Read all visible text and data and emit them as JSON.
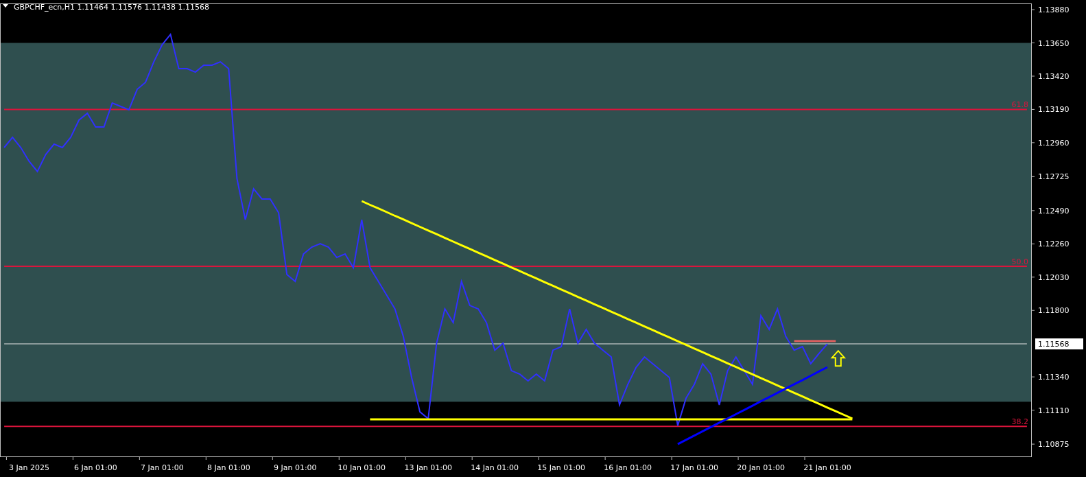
{
  "chart": {
    "current_price": "1.11568",
    "fibonacci_labels": [
      "61.8",
      "50.0",
      "38.2"
    ],
    "chart_data": {
      "type": "line",
      "title": "GBPCHF_ecn,H1  1.11464 1.11576 1.11438 1.11568",
      "categories": [
        null,
        null,
        null,
        "3 Jan 2025",
        null,
        null,
        null,
        null,
        null,
        null,
        null,
        "6 Jan 01:00",
        null,
        null,
        null,
        null,
        null,
        null,
        null,
        "7 Jan 01:00",
        null,
        null,
        null,
        null,
        null,
        null,
        null,
        "8 Jan 01:00",
        null,
        null,
        null,
        null,
        null,
        null,
        null,
        "9 Jan 01:00",
        null,
        null,
        null,
        null,
        null,
        null,
        null,
        "10 Jan 01:00",
        null,
        null,
        null,
        null,
        null,
        null,
        null,
        "13 Jan 01:00",
        null,
        null,
        null,
        null,
        null,
        null,
        null,
        "14 Jan 01:00",
        null,
        null,
        null,
        null,
        null,
        null,
        null,
        "15 Jan 01:00",
        null,
        null,
        null,
        null,
        null,
        null,
        null,
        "16 Jan 01:00",
        null,
        null,
        null,
        null,
        null,
        null,
        null,
        "17 Jan 01:00",
        null,
        null,
        null,
        null,
        null,
        null,
        null,
        "20 Jan 01:00",
        null,
        null,
        null,
        null,
        null,
        null,
        null,
        "21 Jan 01:00",
        null,
        null,
        null,
        null,
        null,
        null,
        null,
        null,
        null,
        null,
        null,
        null,
        null,
        null,
        null,
        null,
        null,
        null,
        null,
        null,
        null,
        null,
        null,
        null
      ],
      "ylim": [
        1.1079,
        1.13923
      ],
      "yticks": [
        {
          "value": 1.1388,
          "label": "1.13880"
        },
        {
          "value": 1.1365,
          "label": "1.13650"
        },
        {
          "value": 1.1342,
          "label": "1.13420"
        },
        {
          "value": 1.1319,
          "label": "1.13190"
        },
        {
          "value": 1.1296,
          "label": "1.12960"
        },
        {
          "value": 1.12725,
          "label": "1.12725"
        },
        {
          "value": 1.1249,
          "label": "1.12490"
        },
        {
          "value": 1.1226,
          "label": "1.12260"
        },
        {
          "value": 1.1203,
          "label": "1.12030"
        },
        {
          "value": 1.118,
          "label": "1.11800"
        },
        {
          "value": 1.1134,
          "label": "1.11340"
        },
        {
          "value": 1.1111,
          "label": "1.11110"
        },
        {
          "value": 1.10875,
          "label": "1.10875"
        }
      ],
      "series": [
        {
          "color": "#dc143c",
          "values": [
            1.1319,
            1.1319,
            1.1319,
            1.1319,
            1.1319,
            1.1319,
            1.1319,
            1.1319,
            1.1319,
            1.1319,
            1.1319,
            1.1319,
            1.1319,
            1.1319,
            1.1319,
            1.1319,
            1.1319,
            1.1319,
            1.1319,
            1.1319,
            1.1319,
            1.1319,
            1.1319,
            1.1319,
            1.1319,
            1.1319,
            1.1319,
            1.1319,
            1.1319,
            1.1319,
            1.1319,
            1.1319,
            1.1319,
            1.1319,
            1.1319,
            1.1319,
            1.1319,
            1.1319,
            1.1319,
            1.1319,
            1.1319,
            1.1319,
            1.1319,
            1.1319,
            1.1319,
            1.1319,
            1.1319,
            1.1319,
            1.1319,
            1.1319,
            1.1319,
            1.1319,
            1.1319,
            1.1319,
            1.1319,
            1.1319,
            1.1319,
            1.1319,
            1.1319,
            1.1319,
            1.1319,
            1.1319,
            1.1319,
            1.1319,
            1.1319,
            1.1319,
            1.1319,
            1.1319,
            1.1319,
            1.1319,
            1.1319,
            1.1319,
            1.1319,
            1.1319,
            1.1319,
            1.1319,
            1.1319,
            1.1319,
            1.1319,
            1.1319,
            1.1319,
            1.1319,
            1.1319,
            1.1319,
            1.1319,
            1.1319,
            1.1319,
            1.1319,
            1.1319,
            1.1319,
            1.1319,
            1.1319,
            1.1319,
            1.1319,
            1.1319,
            1.1319,
            1.1319,
            1.1319,
            1.1319,
            1.1319,
            1.1319,
            1.1319,
            1.1319,
            1.1319,
            1.1319,
            1.1319,
            1.1319,
            1.1319,
            1.1319,
            1.1319,
            1.1319,
            1.1319,
            1.1319,
            1.1319,
            1.1319,
            1.1319,
            1.1319,
            1.1319,
            1.1319,
            1.1319,
            1.1319,
            1.1319,
            1.1319,
            1.1319
          ]
        },
        {
          "color": "#dc143c",
          "values": [
            1.12105,
            1.12105,
            1.12105,
            1.12105,
            1.12105,
            1.12105,
            1.12105,
            1.12105,
            1.12105,
            1.12105,
            1.12105,
            1.12105,
            1.12105,
            1.12105,
            1.12105,
            1.12105,
            1.12105,
            1.12105,
            1.12105,
            1.12105,
            1.12105,
            1.12105,
            1.12105,
            1.12105,
            1.12105,
            1.12105,
            1.12105,
            1.12105,
            1.12105,
            1.12105,
            1.12105,
            1.12105,
            1.12105,
            1.12105,
            1.12105,
            1.12105,
            1.12105,
            1.12105,
            1.12105,
            1.12105,
            1.12105,
            1.12105,
            1.12105,
            1.12105,
            1.12105,
            1.12105,
            1.12105,
            1.12105,
            1.12105,
            1.12105,
            1.12105,
            1.12105,
            1.12105,
            1.12105,
            1.12105,
            1.12105,
            1.12105,
            1.12105,
            1.12105,
            1.12105,
            1.12105,
            1.12105,
            1.12105,
            1.12105,
            1.12105,
            1.12105,
            1.12105,
            1.12105,
            1.12105,
            1.12105,
            1.12105,
            1.12105,
            1.12105,
            1.12105,
            1.12105,
            1.12105,
            1.12105,
            1.12105,
            1.12105,
            1.12105,
            1.12105,
            1.12105,
            1.12105,
            1.12105,
            1.12105,
            1.12105,
            1.12105,
            1.12105,
            1.12105,
            1.12105,
            1.12105,
            1.12105,
            1.12105,
            1.12105,
            1.12105,
            1.12105,
            1.12105,
            1.12105,
            1.12105,
            1.12105,
            1.12105,
            1.12105,
            1.12105,
            1.12105,
            1.12105,
            1.12105,
            1.12105,
            1.12105,
            1.12105,
            1.12105,
            1.12105,
            1.12105,
            1.12105,
            1.12105,
            1.12105,
            1.12105,
            1.12105,
            1.12105,
            1.12105,
            1.12105,
            1.12105,
            1.12105,
            1.12105,
            1.12105
          ]
        },
        {
          "color": "#dc143c",
          "values": [
            1.10998,
            1.10998,
            1.10998,
            1.10998,
            1.10998,
            1.10998,
            1.10998,
            1.10998,
            1.10998,
            1.10998,
            1.10998,
            1.10998,
            1.10998,
            1.10998,
            1.10998,
            1.10998,
            1.10998,
            1.10998,
            1.10998,
            1.10998,
            1.10998,
            1.10998,
            1.10998,
            1.10998,
            1.10998,
            1.10998,
            1.10998,
            1.10998,
            1.10998,
            1.10998,
            1.10998,
            1.10998,
            1.10998,
            1.10998,
            1.10998,
            1.10998,
            1.10998,
            1.10998,
            1.10998,
            1.10998,
            1.10998,
            1.10998,
            1.10998,
            1.10998,
            1.10998,
            1.10998,
            1.10998,
            1.10998,
            1.10998,
            1.10998,
            1.10998,
            1.10998,
            1.10998,
            1.10998,
            1.10998,
            1.10998,
            1.10998,
            1.10998,
            1.10998,
            1.10998,
            1.10998,
            1.10998,
            1.10998,
            1.10998,
            1.10998,
            1.10998,
            1.10998,
            1.10998,
            1.10998,
            1.10998,
            1.10998,
            1.10998,
            1.10998,
            1.10998,
            1.10998,
            1.10998,
            1.10998,
            1.10998,
            1.10998,
            1.10998,
            1.10998,
            1.10998,
            1.10998,
            1.10998,
            1.10998,
            1.10998,
            1.10998,
            1.10998,
            1.10998,
            1.10998,
            1.10998,
            1.10998,
            1.10998,
            1.10998,
            1.10998,
            1.10998,
            1.10998,
            1.10998,
            1.10998,
            1.10998,
            1.10998,
            1.10998,
            1.10998,
            1.10998,
            1.10998,
            1.10998,
            1.10998,
            1.10998,
            1.10998,
            1.10998,
            1.10998,
            1.10998,
            1.10998,
            1.10998,
            1.10998,
            1.10998,
            1.10998,
            1.10998,
            1.10998,
            1.10998,
            1.10998,
            1.10998,
            1.10998,
            1.10998
          ]
        },
        {
          "color": "#8a9a9a",
          "values": [
            1.11568,
            1.11568,
            1.11568,
            1.11568,
            1.11568,
            1.11568,
            1.11568,
            1.11568,
            1.11568,
            1.11568,
            1.11568,
            1.11568,
            1.11568,
            1.11568,
            1.11568,
            1.11568,
            1.11568,
            1.11568,
            1.11568,
            1.11568,
            1.11568,
            1.11568,
            1.11568,
            1.11568,
            1.11568,
            1.11568,
            1.11568,
            1.11568,
            1.11568,
            1.11568,
            1.11568,
            1.11568,
            1.11568,
            1.11568,
            1.11568,
            1.11568,
            1.11568,
            1.11568,
            1.11568,
            1.11568,
            1.11568,
            1.11568,
            1.11568,
            1.11568,
            1.11568,
            1.11568,
            1.11568,
            1.11568,
            1.11568,
            1.11568,
            1.11568,
            1.11568,
            1.11568,
            1.11568,
            1.11568,
            1.11568,
            1.11568,
            1.11568,
            1.11568,
            1.11568,
            1.11568,
            1.11568,
            1.11568,
            1.11568,
            1.11568,
            1.11568,
            1.11568,
            1.11568,
            1.11568,
            1.11568,
            1.11568,
            1.11568,
            1.11568,
            1.11568,
            1.11568,
            1.11568,
            1.11568,
            1.11568,
            1.11568,
            1.11568,
            1.11568,
            1.11568,
            1.11568,
            1.11568,
            1.11568,
            1.11568,
            1.11568,
            1.11568,
            1.11568,
            1.11568,
            1.11568,
            1.11568,
            1.11568,
            1.11568,
            1.11568,
            1.11568,
            1.11568,
            1.11568,
            1.11568,
            1.11568,
            1.11568,
            1.11568,
            1.11568,
            1.11568,
            1.11568,
            1.11568,
            1.11568,
            1.11568,
            1.11568,
            1.11568,
            1.11568,
            1.11568,
            1.11568,
            1.11568,
            1.11568,
            1.11568,
            1.11568,
            1.11568,
            1.11568,
            1.11568,
            1.11568,
            1.11568,
            1.11568,
            1.11568
          ]
        },
        {
          "color": "#3030ff",
          "values": [
            1.12926,
            1.12997,
            1.12926,
            1.12831,
            1.1276,
            1.12878,
            1.1295,
            1.12926,
            1.12997,
            1.13116,
            1.13163,
            1.13068,
            1.13068,
            1.13234,
            1.13211,
            1.13187,
            1.13329,
            1.13377,
            1.13519,
            1.13638,
            1.13709,
            1.13472,
            1.13472,
            1.13448,
            1.13496,
            1.13496,
            1.13519,
            1.13472,
            1.12712,
            1.12427,
            1.12641,
            1.1257,
            1.1257,
            1.12475,
            1.12048,
            1.12,
            1.1219,
            1.12238,
            1.12261,
            1.12238,
            1.12166,
            1.1219,
            1.12095,
            1.12427,
            1.12095,
            1.12,
            1.11905,
            1.1181,
            1.1162,
            1.11336,
            1.11098,
            1.11051,
            1.11573,
            1.1181,
            1.11715,
            1.12,
            1.11834,
            1.1181,
            1.11715,
            1.11525,
            1.11573,
            1.11383,
            1.11359,
            1.11312,
            1.11359,
            1.11312,
            1.11525,
            1.11549,
            1.1181,
            1.11573,
            1.11668,
            1.11573,
            1.11525,
            1.11478,
            1.11146,
            1.11288,
            1.11407,
            1.11478,
            1.11431,
            1.11383,
            1.11336,
            1.11003,
            1.11193,
            1.11288,
            1.11431,
            1.11359,
            1.11146,
            1.11383,
            1.11478,
            1.11383,
            1.11288,
            1.11763,
            1.11668,
            1.1181,
            1.1162,
            1.11525,
            1.11549,
            1.11431,
            1.11502,
            1.11568,
            null,
            null,
            null,
            null,
            null,
            null,
            null,
            null,
            null,
            null,
            null,
            null,
            null,
            null,
            null,
            null,
            null,
            null,
            null,
            null,
            null,
            null,
            null,
            null
          ]
        },
        {
          "color": "#ffff00",
          "values": [
            null,
            null,
            null,
            null,
            null,
            null,
            null,
            null,
            null,
            null,
            null,
            null,
            null,
            null,
            null,
            null,
            null,
            null,
            null,
            null,
            null,
            null,
            null,
            null,
            null,
            null,
            null,
            null,
            null,
            null,
            null,
            null,
            null,
            null,
            null,
            null,
            null,
            null,
            null,
            null,
            null,
            null,
            null,
            1.12556,
            1.1253,
            1.12505,
            1.1248,
            1.12454,
            1.12429,
            1.12403,
            1.12378,
            1.12352,
            1.12327,
            1.12301,
            1.12276,
            1.1225,
            1.12225,
            1.12199,
            1.12174,
            1.12148,
            1.12123,
            1.12097,
            1.12072,
            1.12046,
            1.12021,
            1.11995,
            1.1197,
            1.11944,
            1.11919,
            1.11893,
            1.11868,
            1.11842,
            1.11817,
            1.11791,
            1.11766,
            1.1174,
            1.11715,
            1.11689,
            1.11664,
            1.11638,
            1.11613,
            1.11587,
            1.11562,
            1.11536,
            1.11511,
            1.11485,
            1.1146,
            1.11434,
            1.11409,
            1.11383,
            1.11358,
            1.11332,
            1.11307,
            1.11281,
            1.11256,
            1.1123,
            1.11205,
            1.11179,
            1.11154,
            1.11128,
            1.11103,
            1.11077,
            1.11052,
            null,
            null,
            null,
            null,
            null,
            null,
            null,
            null,
            null,
            null,
            null,
            null,
            null,
            null,
            null,
            null,
            null,
            null,
            null,
            null,
            null
          ]
        },
        {
          "color": "#ffff00",
          "values": [
            null,
            null,
            null,
            null,
            null,
            null,
            null,
            null,
            null,
            null,
            null,
            null,
            null,
            null,
            null,
            null,
            null,
            null,
            null,
            null,
            null,
            null,
            null,
            null,
            null,
            null,
            null,
            null,
            null,
            null,
            null,
            null,
            null,
            null,
            null,
            null,
            null,
            null,
            null,
            null,
            null,
            null,
            null,
            null,
            1.11046,
            1.11046,
            1.11046,
            1.11046,
            1.11046,
            1.11046,
            1.11046,
            1.11046,
            1.11046,
            1.11046,
            1.11046,
            1.11046,
            1.11046,
            1.11046,
            1.11046,
            1.11046,
            1.11046,
            1.11046,
            1.11046,
            1.11046,
            1.11046,
            1.11046,
            1.11046,
            1.11046,
            1.11046,
            1.11046,
            1.11046,
            1.11046,
            1.11046,
            1.11046,
            1.11046,
            1.11046,
            1.11046,
            1.11046,
            1.11046,
            1.11046,
            1.11046,
            1.11046,
            1.11046,
            1.11046,
            1.11046,
            1.11046,
            1.11046,
            1.11046,
            1.11046,
            1.11046,
            1.11046,
            1.11046,
            1.11046,
            1.11046,
            1.11046,
            1.11046,
            1.11046,
            1.11046,
            1.11046,
            1.11046,
            1.11046,
            1.11046,
            1.11046,
            null,
            null,
            null,
            null,
            null,
            null,
            null,
            null,
            null,
            null,
            null,
            null,
            null,
            null,
            null,
            null,
            null,
            null,
            null,
            null,
            null
          ]
        },
        {
          "color": "#0000ff",
          "values": [
            null,
            null,
            null,
            null,
            null,
            null,
            null,
            null,
            null,
            null,
            null,
            null,
            null,
            null,
            null,
            null,
            null,
            null,
            null,
            null,
            null,
            null,
            null,
            null,
            null,
            null,
            null,
            null,
            null,
            null,
            null,
            null,
            null,
            null,
            null,
            null,
            null,
            null,
            null,
            null,
            null,
            null,
            null,
            null,
            null,
            null,
            null,
            null,
            null,
            null,
            null,
            null,
            null,
            null,
            null,
            null,
            null,
            null,
            null,
            null,
            null,
            null,
            null,
            null,
            null,
            null,
            null,
            null,
            null,
            null,
            null,
            null,
            null,
            null,
            null,
            null,
            null,
            null,
            null,
            null,
            null,
            1.10875,
            1.10905,
            1.10934,
            1.10964,
            1.10993,
            1.11023,
            1.11052,
            1.11082,
            1.11111,
            1.11141,
            1.11171,
            1.112,
            1.1123,
            1.11259,
            1.11289,
            1.11318,
            1.11348,
            1.11378,
            1.11407,
            null,
            null,
            null,
            null,
            null,
            null,
            null,
            null,
            null,
            null,
            null,
            null,
            null,
            null,
            null,
            null,
            null,
            null,
            null,
            null,
            null,
            null,
            null,
            null
          ]
        },
        {
          "color": "#e06060",
          "values": [
            null,
            null,
            null,
            null,
            null,
            null,
            null,
            null,
            null,
            null,
            null,
            null,
            null,
            null,
            null,
            null,
            null,
            null,
            null,
            null,
            null,
            null,
            null,
            null,
            null,
            null,
            null,
            null,
            null,
            null,
            null,
            null,
            null,
            null,
            null,
            null,
            null,
            null,
            null,
            null,
            null,
            null,
            null,
            null,
            null,
            null,
            null,
            null,
            null,
            null,
            null,
            null,
            null,
            null,
            null,
            null,
            null,
            null,
            null,
            null,
            null,
            null,
            null,
            null,
            null,
            null,
            null,
            null,
            null,
            null,
            null,
            null,
            null,
            null,
            null,
            null,
            null,
            null,
            null,
            null,
            null,
            null,
            null,
            null,
            null,
            null,
            null,
            null,
            null,
            null,
            null,
            null,
            null,
            null,
            null,
            1.11587,
            1.11587,
            1.11587,
            1.11587,
            1.11587,
            1.11587,
            null,
            null,
            null,
            null,
            null,
            null,
            null,
            null,
            null,
            null,
            null,
            null,
            null,
            null,
            null,
            null,
            null,
            null,
            null,
            null,
            null,
            null,
            null
          ]
        }
      ]
    }
  }
}
